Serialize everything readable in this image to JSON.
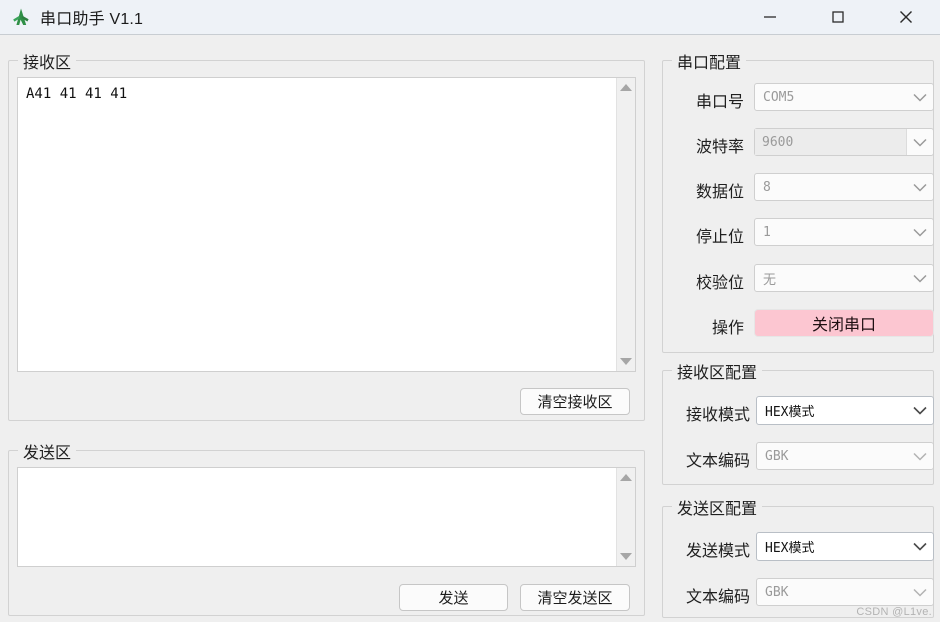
{
  "window": {
    "title": "串口助手 V1.1",
    "icon": "app-logo-icon",
    "minimize_label": "minimize-icon",
    "maximize_label": "maximize-icon",
    "close_label": "close-icon",
    "titlebar_color": "#eef2f7",
    "body_color": "#efefef"
  },
  "receive_area": {
    "group_title": "接收区",
    "content": "A41 41 41 41",
    "clear_button": "清空接收区",
    "scroll_up_icon": "scroll-up-arrow-icon",
    "scroll_down_icon": "scroll-down-arrow-icon"
  },
  "send_area": {
    "group_title": "发送区",
    "content": "",
    "send_button": "发送",
    "clear_button": "清空发送区",
    "scroll_up_icon": "scroll-up-arrow-icon",
    "scroll_down_icon": "scroll-down-arrow-icon"
  },
  "serial_config": {
    "group_title": "串口配置",
    "fields": [
      {
        "label": "串口号",
        "value": "COM5",
        "enabled": false,
        "editable": false
      },
      {
        "label": "波特率",
        "value": "9600",
        "enabled": false,
        "editable": true
      },
      {
        "label": "数据位",
        "value": "8",
        "enabled": false,
        "editable": false
      },
      {
        "label": "停止位",
        "value": "1",
        "enabled": false,
        "editable": false
      },
      {
        "label": "校验位",
        "value": "无",
        "enabled": false,
        "editable": false
      }
    ],
    "action_label": "操作",
    "action_button": "关闭串口",
    "action_button_color": "#fcc6d1"
  },
  "receive_config": {
    "group_title": "接收区配置",
    "fields": [
      {
        "label": "接收模式",
        "value": "HEX模式",
        "enabled": true
      },
      {
        "label": "文本编码",
        "value": "GBK",
        "enabled": false
      }
    ]
  },
  "send_config": {
    "group_title": "发送区配置",
    "fields": [
      {
        "label": "发送模式",
        "value": "HEX模式",
        "enabled": true
      },
      {
        "label": "文本编码",
        "value": "GBK",
        "enabled": false
      }
    ]
  },
  "watermark": "CSDN @L1ve."
}
